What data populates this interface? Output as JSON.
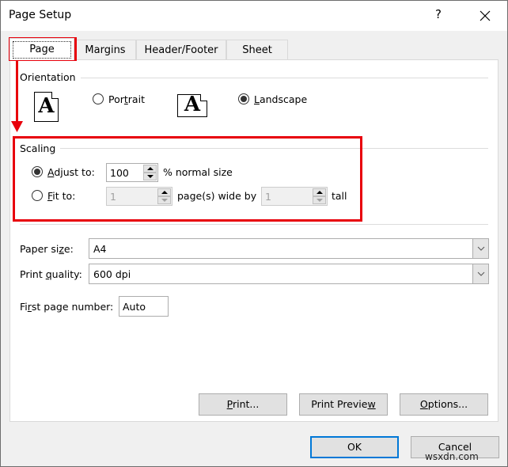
{
  "window": {
    "title": "Page Setup",
    "help_label": "?",
    "close_icon": "close-icon"
  },
  "tabs": [
    {
      "label": "Page",
      "active": true
    },
    {
      "label": "Margins",
      "active": false
    },
    {
      "label": "Header/Footer",
      "active": false
    },
    {
      "label": "Sheet",
      "active": false
    }
  ],
  "orientation": {
    "group_label": "Orientation",
    "portrait": {
      "label_pre": "Por",
      "label_u": "t",
      "label_post": "rait",
      "checked": false,
      "icon": "portrait-page-icon",
      "glyph": "A"
    },
    "landscape": {
      "label_pre": "",
      "label_u": "L",
      "label_post": "andscape",
      "checked": true,
      "icon": "landscape-page-icon",
      "glyph": "A"
    }
  },
  "scaling": {
    "group_label": "Scaling",
    "adjust_to": {
      "label_u": "A",
      "label_post": "djust to:",
      "checked": true,
      "value": "100",
      "suffix": "% normal size"
    },
    "fit_to": {
      "label_u": "F",
      "label_post": "it to:",
      "checked": false,
      "wide_value": "1",
      "wide_suffix": "page(s) wide by",
      "tall_value": "1",
      "tall_suffix": "tall"
    }
  },
  "paper_size": {
    "label_pre": "Paper si",
    "label_u": "z",
    "label_post": "e:",
    "value": "A4"
  },
  "print_quality": {
    "label_pre": "Print ",
    "label_u": "q",
    "label_post": "uality:",
    "value": "600 dpi"
  },
  "first_page_number": {
    "label_pre": "Fi",
    "label_u": "r",
    "label_post": "st page number:",
    "value": "Auto"
  },
  "buttons": {
    "print": {
      "pre": "",
      "u": "P",
      "post": "rint..."
    },
    "print_preview": {
      "pre": "Print Previe",
      "u": "w",
      "post": ""
    },
    "options": {
      "pre": "",
      "u": "O",
      "post": "ptions..."
    },
    "ok": "OK",
    "cancel": "Cancel"
  },
  "annotation": {
    "color": "#e8000b"
  },
  "watermark": "wsxdn.com"
}
